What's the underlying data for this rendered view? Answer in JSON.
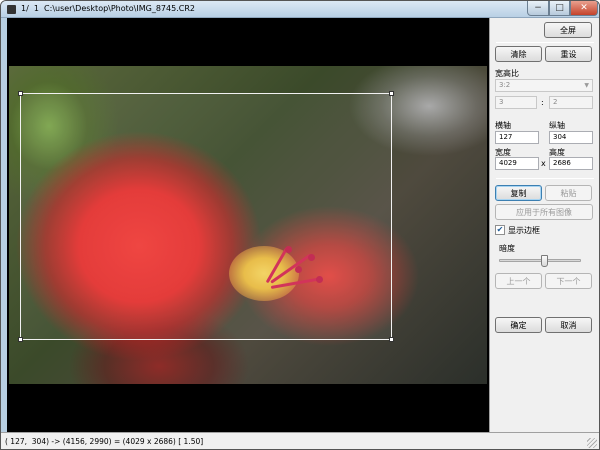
{
  "window": {
    "title": "1/  1  C:\\user\\Desktop\\Photo\\IMG_8745.CR2",
    "minimize_glyph": "−",
    "maximize_glyph": "□",
    "close_glyph": "✕"
  },
  "panel": {
    "fullscreen_label": "全屏",
    "clear_label": "清除",
    "reset_label": "重设",
    "aspect_ratio_label": "宽高比",
    "aspect_ratio_value": "3:2",
    "aspect_w": "3",
    "aspect_colon": ":",
    "aspect_h": "2",
    "x_axis_label": "横轴",
    "x_axis_value": "127",
    "y_axis_label": "纵轴",
    "y_axis_value": "304",
    "width_label": "宽度",
    "width_value": "4029",
    "times_sign": "x",
    "height_label": "高度",
    "height_value": "2686",
    "copy_label": "复制",
    "paste_label": "粘贴",
    "apply_all_label": "应用于所有图像",
    "show_border_label": "显示边框",
    "show_border_checked": true,
    "darkness_label": "暗度",
    "darkness_level": 0.55,
    "prev_label": "上一个",
    "next_label": "下一个",
    "ok_label": "确定",
    "cancel_label": "取消"
  },
  "status": {
    "text": "( 127,  304) -> (4156, 2990) = (4029 x 2686) [ 1.50]"
  },
  "colors": {
    "accent": "#3c7fb1",
    "panel_bg": "#f0f0f0",
    "viewer_bg": "#000000",
    "crop_border": "#f2f2f2"
  },
  "icons": {
    "app": "app-icon",
    "checkbox_check": "✔",
    "dropdown": "▼"
  }
}
